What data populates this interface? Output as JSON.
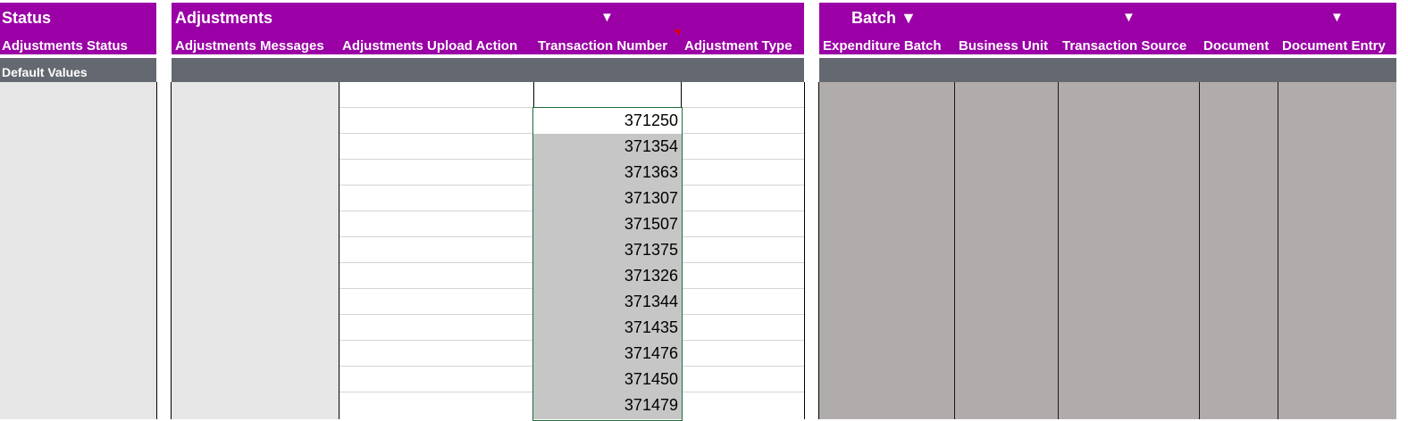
{
  "groups": {
    "status": {
      "title": "Status"
    },
    "adjustments": {
      "title": "Adjustments",
      "filter_icon": "filter-dropdown-arrow"
    },
    "batch": {
      "title": "Batch ▼",
      "filter_icon": "filter-dropdown-arrow"
    }
  },
  "columns": {
    "adjustments_status": "Adjustments Status",
    "adjustments_messages": "Adjustments Messages",
    "adjustments_upload_action": "Adjustments Upload Action",
    "transaction_number": "Transaction Number",
    "adjustment_type": "Adjustment Type",
    "expenditure_batch": "Expenditure Batch",
    "business_unit": "Business Unit",
    "transaction_source": "Transaction Source",
    "document": "Document",
    "document_entry": "Document Entry"
  },
  "arrow_glyph": "▼",
  "default_values": {
    "label": "Default Values"
  },
  "transaction_numbers": [
    "371250",
    "371354",
    "371363",
    "371307",
    "371507",
    "371375",
    "371326",
    "371344",
    "371435",
    "371476",
    "371450",
    "371479"
  ],
  "colors": {
    "header_bg": "#9a00a6",
    "default_bar_bg": "#646870",
    "readonly_light": "#e6e6e6",
    "readonly_dark": "#b0acab",
    "selected_cell": "#c6c6c6",
    "selection_border": "#1e6b3c",
    "comment_marker": "#e00000"
  }
}
